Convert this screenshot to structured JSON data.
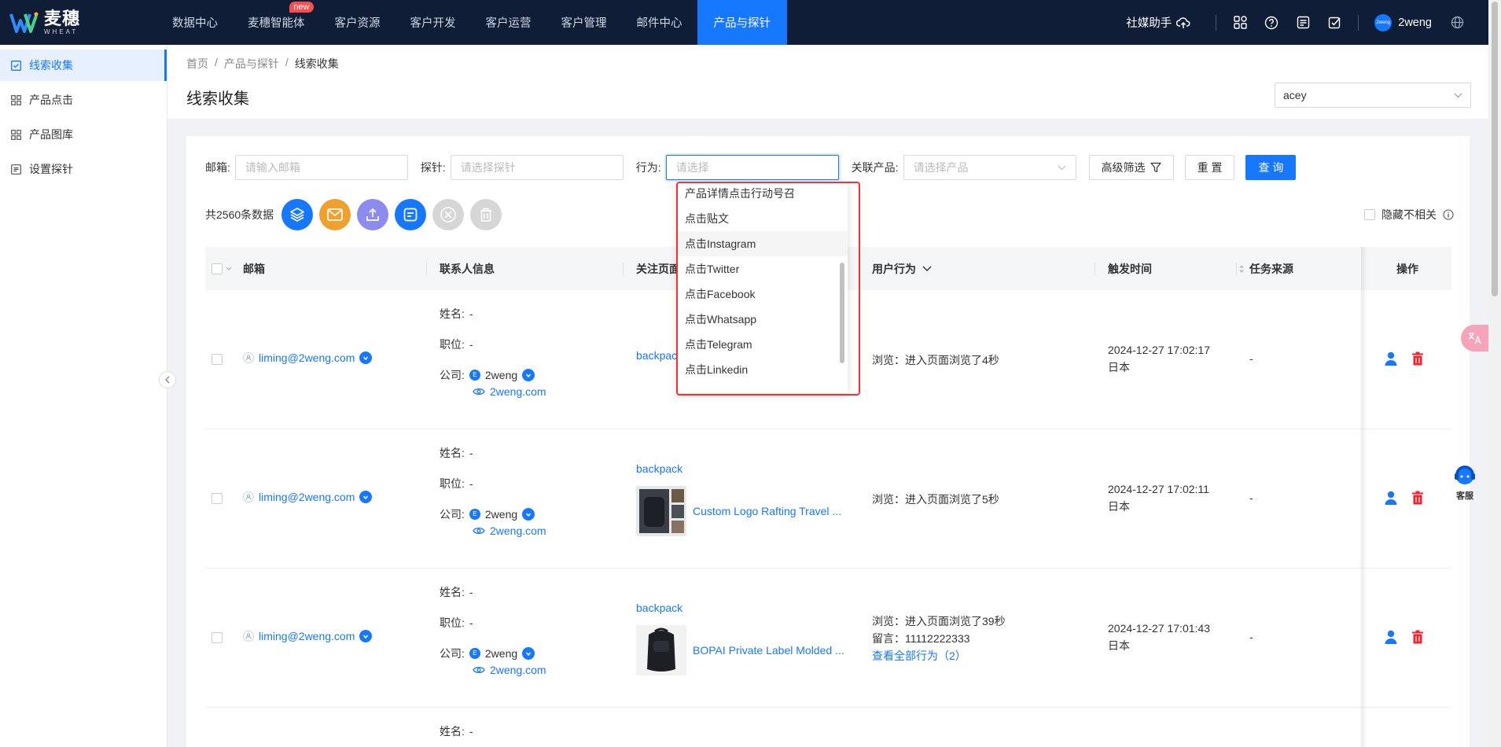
{
  "brand": {
    "name_cn": "麦穗",
    "name_en": "WHEAT"
  },
  "nav": {
    "items": [
      "数据中心",
      "麦穗智能体",
      "客户资源",
      "客户开发",
      "客户运营",
      "客户管理",
      "邮件中心",
      "产品与探针"
    ],
    "new_badge": "new",
    "active": "产品与探针"
  },
  "topright": {
    "social": "社媒助手",
    "avatar_text": "2weng",
    "user": "2weng"
  },
  "sidebar": {
    "items": [
      "线索收集",
      "产品点击",
      "产品图库",
      "设置探针"
    ]
  },
  "breadcrumb": {
    "home": "首页",
    "mid": "产品与探针",
    "current": "线索收集"
  },
  "page": {
    "title": "线索收集",
    "account": "acey"
  },
  "filters": {
    "email_label": "邮箱:",
    "email_placeholder": "请输入邮箱",
    "probe_label": "探针:",
    "probe_placeholder": "请选择探针",
    "action_label": "行为:",
    "action_placeholder": "请选择",
    "product_label": "关联产品:",
    "product_placeholder": "请选择产品",
    "advanced": "高级筛选",
    "reset": "重 置",
    "query": "查 询"
  },
  "toolbar": {
    "count": "共2560条数据",
    "hide_irrelevant": "隐藏不相关"
  },
  "table": {
    "columns": [
      "邮箱",
      "联系人信息",
      "关注页面",
      "用户行为",
      "触发时间",
      "任务来源",
      "操作"
    ],
    "contact_keys": {
      "name": "姓名:",
      "title": "职位:",
      "company": "公司:"
    },
    "rows": [
      {
        "email": "liming@2weng.com",
        "name": "-",
        "title": "-",
        "company": "2weng",
        "site": "2weng.com",
        "page_tag": "backpack",
        "product": "",
        "behavior": [
          "浏览：进入页面浏览了4秒"
        ],
        "time": "2024-12-27 17:02:17",
        "country": "日本",
        "source": "-"
      },
      {
        "email": "liming@2weng.com",
        "name": "-",
        "title": "-",
        "company": "2weng",
        "site": "2weng.com",
        "page_tag": "backpack",
        "product": "Custom Logo Rafting Travel ...",
        "behavior": [
          "浏览：进入页面浏览了5秒"
        ],
        "time": "2024-12-27 17:02:11",
        "country": "日本",
        "source": "-"
      },
      {
        "email": "liming@2weng.com",
        "name": "-",
        "title": "-",
        "company": "2weng",
        "site": "2weng.com",
        "page_tag": "backpack",
        "product": "BOPAI Private Label Molded ...",
        "behavior": [
          "浏览：进入页面浏览了39秒",
          "留言：11112222333"
        ],
        "behavior_link": "查看全部行为（2）",
        "time": "2024-12-27 17:01:43",
        "country": "日本",
        "source": "-"
      },
      {
        "name": "-"
      }
    ]
  },
  "dropdown": {
    "options": [
      "产品详情点击行动号召",
      "点击贴文",
      "点击Instagram",
      "点击Twitter",
      "点击Facebook",
      "点击Whatsapp",
      "点击Telegram",
      "点击Linkedin"
    ],
    "hovered": "点击Instagram"
  },
  "floating": {
    "service": "客服"
  },
  "colors": {
    "nav_bg": "#0f1d36",
    "primary": "#1677ff",
    "danger": "#f5222d",
    "highlight": "#ff2d2d"
  }
}
